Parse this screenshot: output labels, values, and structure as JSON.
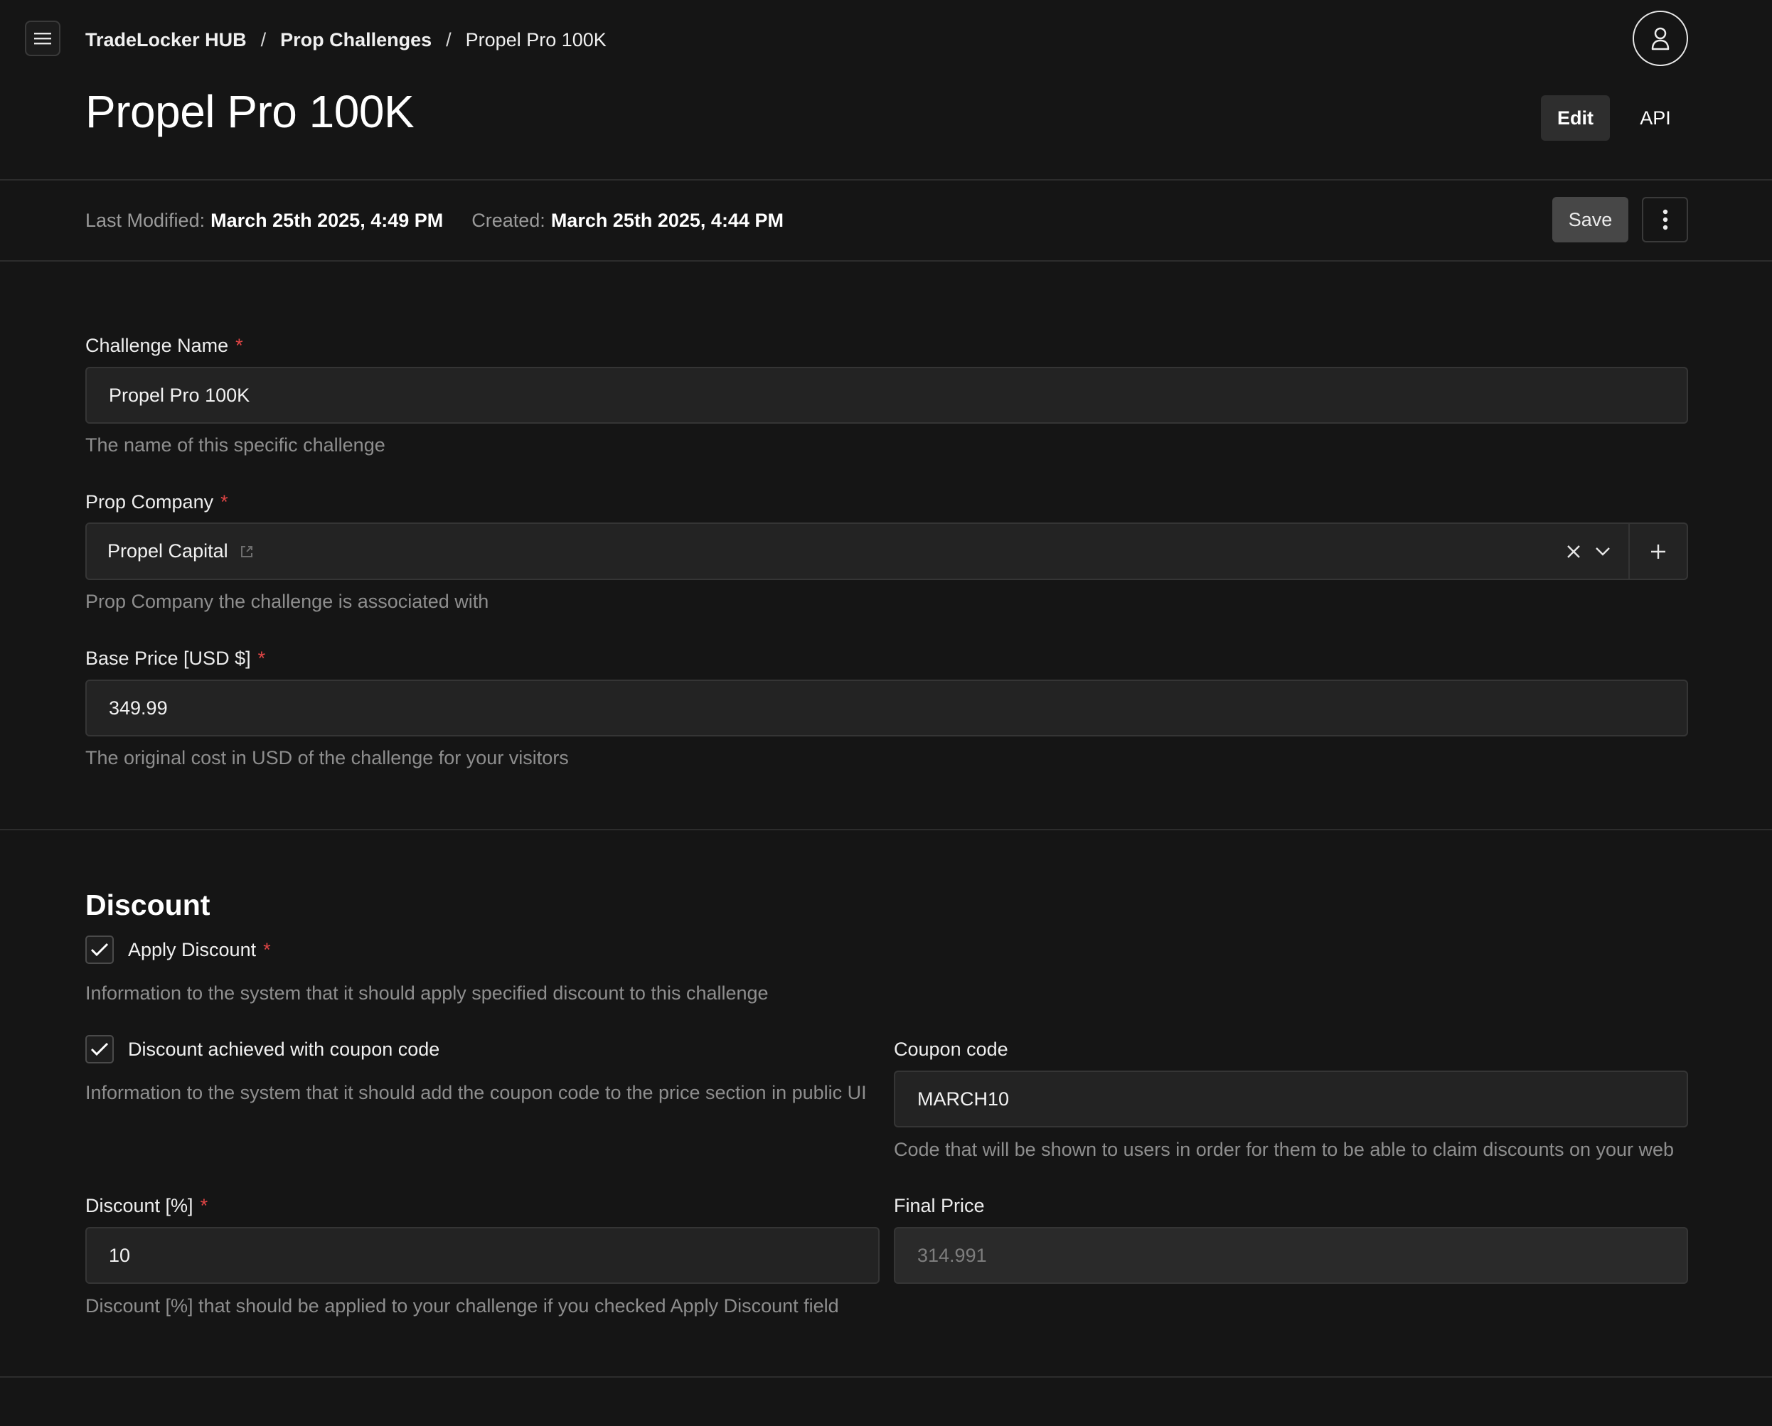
{
  "breadcrumb": {
    "root": "TradeLocker HUB",
    "parent": "Prop Challenges",
    "current": "Propel Pro 100K",
    "separator": "/"
  },
  "header": {
    "title": "Propel Pro 100K",
    "edit_label": "Edit",
    "api_label": "API"
  },
  "meta": {
    "modified_label": "Last Modified:",
    "modified_value": "March 25th 2025, 4:49 PM",
    "created_label": "Created:",
    "created_value": "March 25th 2025, 4:44 PM",
    "save_label": "Save"
  },
  "form": {
    "challenge_name": {
      "label": "Challenge Name",
      "required": "*",
      "value": "Propel Pro 100K",
      "help": "The name of this specific challenge"
    },
    "prop_company": {
      "label": "Prop Company",
      "required": "*",
      "value": "Propel Capital",
      "help": "Prop Company the challenge is associated with"
    },
    "base_price": {
      "label": "Base Price [USD $]",
      "required": "*",
      "value": "349.99",
      "help": "The original cost in USD of the challenge for your visitors"
    }
  },
  "discount": {
    "title": "Discount",
    "apply": {
      "label": "Apply Discount",
      "required": "*",
      "checked": true,
      "help": "Information to the system that it should apply specified discount to this challenge"
    },
    "coupon_toggle": {
      "label": "Discount achieved with coupon code",
      "checked": true,
      "help": "Information to the system that it should add the coupon code to the price section in public UI"
    },
    "coupon_code": {
      "label": "Coupon code",
      "value": "MARCH10",
      "help": "Code that will be shown to users in order for them to be able to claim discounts on your web"
    },
    "percent": {
      "label": "Discount [%]",
      "required": "*",
      "value": "10",
      "help": "Discount [%] that should be applied to your challenge if you checked Apply Discount field"
    },
    "final_price": {
      "label": "Final Price",
      "value": "314.991"
    }
  },
  "icons": {
    "menu": "hamburger-icon",
    "avatar": "user-icon",
    "more": "vertical-dots-icon",
    "external": "external-link-icon",
    "clear": "close-icon",
    "dropdown": "chevron-down-icon",
    "add": "plus-icon",
    "check": "checkmark-icon"
  },
  "colors": {
    "background": "#151515",
    "input": "#232323",
    "required": "#e04545",
    "muted": "#8e8e8e"
  }
}
